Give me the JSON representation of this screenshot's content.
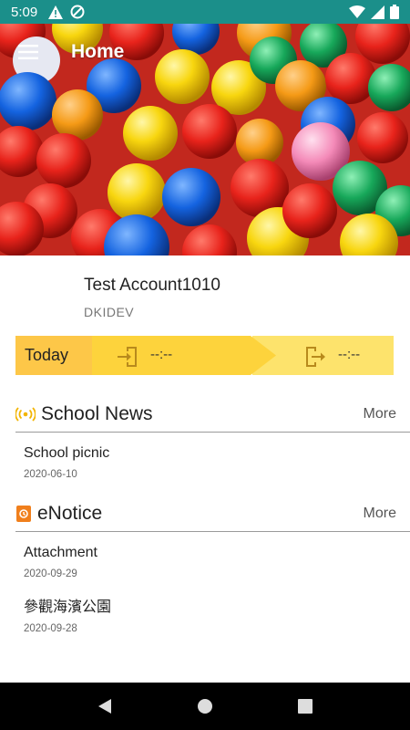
{
  "status_bar": {
    "time": "5:09"
  },
  "app_bar": {
    "title": "Home"
  },
  "profile": {
    "name": "Test Account1010",
    "school": "DKIDEV"
  },
  "attendance": {
    "today_label": "Today",
    "check_in_time": "--:--",
    "check_out_time": "--:--"
  },
  "school_news": {
    "title": "School News",
    "more_label": "More",
    "items": [
      {
        "title": "School picnic",
        "date": "2020-06-10"
      }
    ]
  },
  "enotice": {
    "title": "eNotice",
    "more_label": "More",
    "items": [
      {
        "title": "Attachment",
        "date": "2020-09-29"
      },
      {
        "title": "參觀海濱公園",
        "date": "2020-09-28"
      }
    ]
  },
  "colors": {
    "status_bar": "#1b8f8a",
    "today_bg": "#fdc748",
    "check_in_bg": "#fdd33c",
    "check_out_bg": "#fde36c",
    "news_icon": "#f2b400",
    "enotice_icon": "#f07f1c"
  }
}
